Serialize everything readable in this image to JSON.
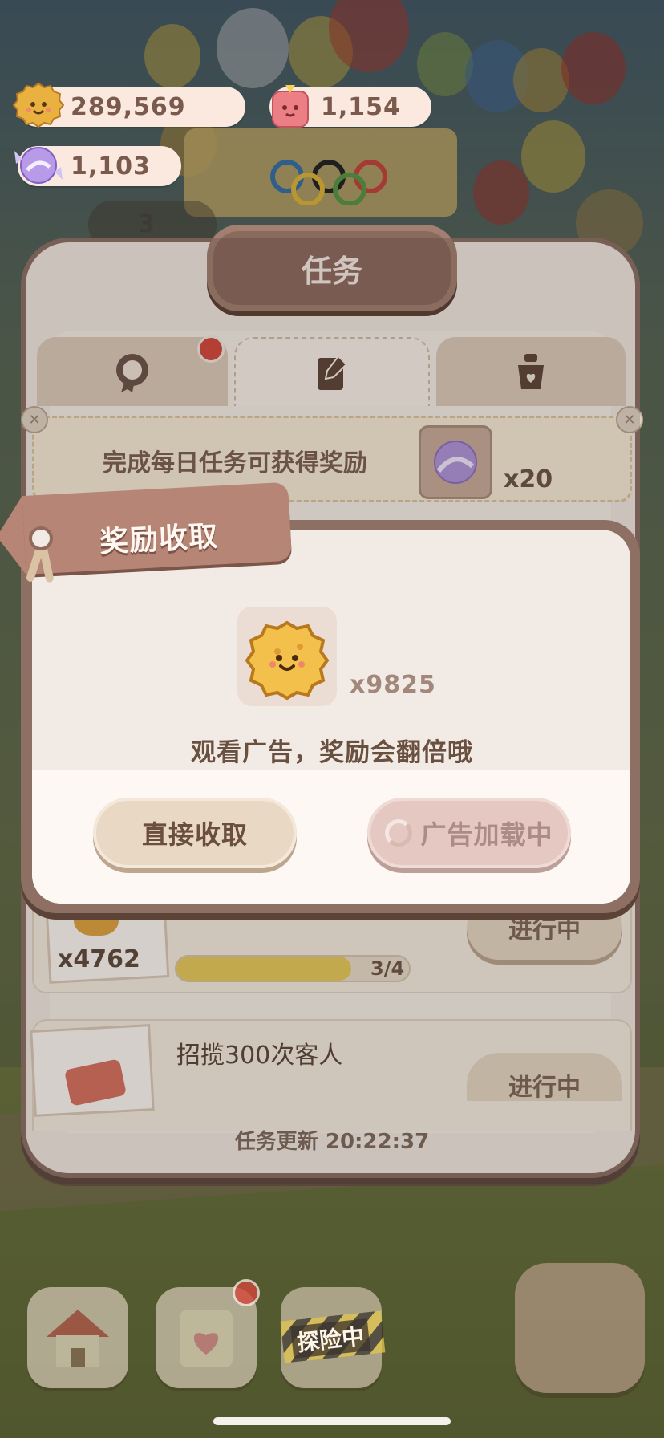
{
  "resources": {
    "cookies": {
      "value": "289,569",
      "icon": "cookie-coin-icon"
    },
    "jelly": {
      "value": "1,154",
      "icon": "jelly-cube-icon"
    },
    "candy": {
      "value": "1,103",
      "icon": "candy-icon"
    }
  },
  "event_banner_count": "3",
  "panel": {
    "title": "任务",
    "tabs": [
      {
        "icon": "medal-icon",
        "has_alert": true
      },
      {
        "icon": "notepad-icon",
        "active": true
      },
      {
        "icon": "pot-icon"
      }
    ],
    "daily_banner": {
      "text": "完成每日任务可获得奖励",
      "reward_icon": "candy-icon",
      "reward_qty": "x20"
    },
    "tasks": [
      {
        "reward_qty": "x4762",
        "progress": 0.75,
        "progress_text": "3/4",
        "status": "进行中"
      },
      {
        "title": "招揽300次客人",
        "status": "进行中"
      }
    ],
    "refresh_text": "任务更新 20:22:37"
  },
  "popup": {
    "tag_title": "奖励收取",
    "reward": {
      "icon": "cookie-coin-icon",
      "qty": "x9825"
    },
    "hint": "观看广告，奖励会翻倍哦",
    "claim_button": "直接收取",
    "ad_button": "广告加载中"
  },
  "dock": {
    "adventure_label": "探险中"
  },
  "colors": {
    "popup_tag": "#b68575",
    "panel_border": "#8a6e62",
    "alert": "#d2473b"
  }
}
